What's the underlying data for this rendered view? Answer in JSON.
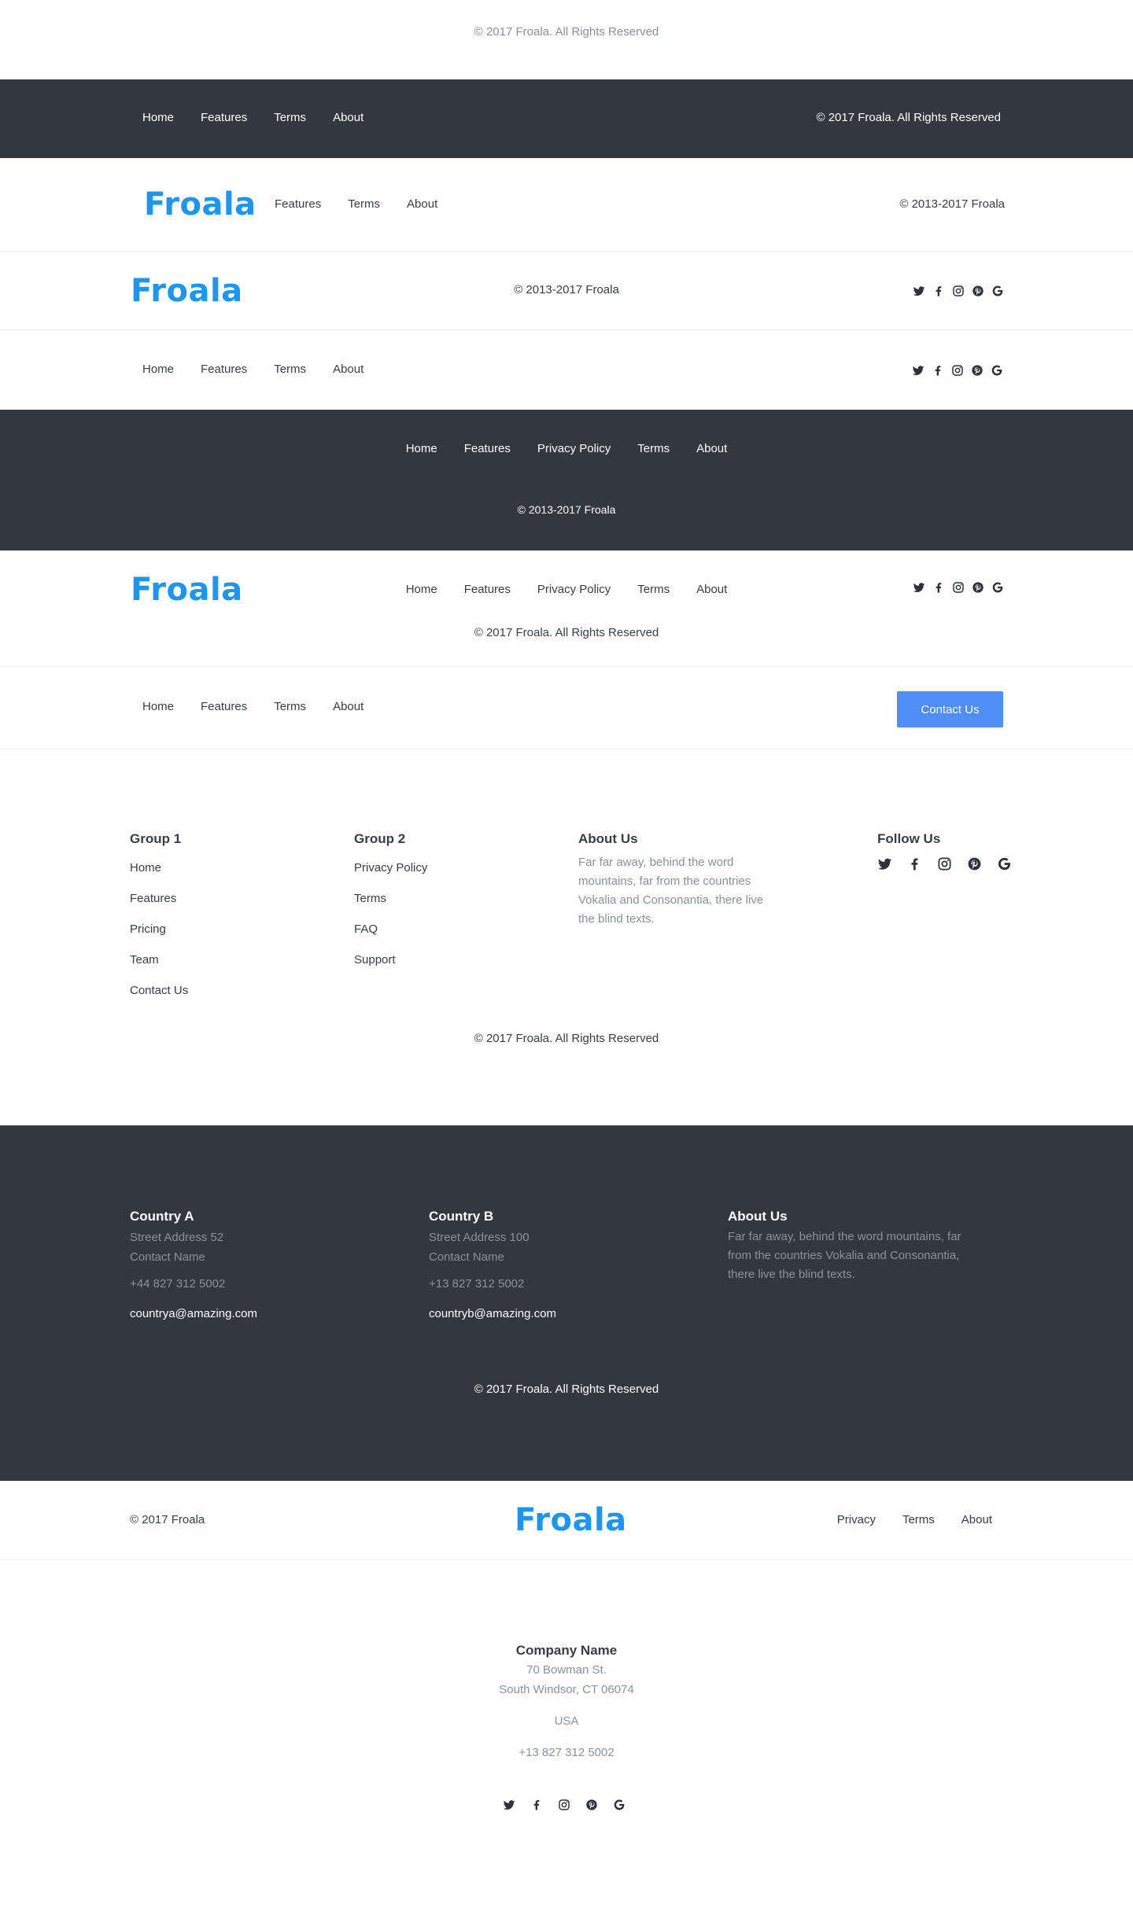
{
  "brand": {
    "logo": "Froala",
    "accent": "#1e95f0",
    "dark_bg": "#33373f",
    "button_color": "#4f8ff7"
  },
  "icons": [
    "twitter-icon",
    "facebook-icon",
    "instagram-icon",
    "pinterest-icon",
    "google-icon"
  ],
  "f1": {
    "copyright": "© 2017 Froala. All Rights Reserved"
  },
  "f2": {
    "nav": [
      "Home",
      "Features",
      "Terms",
      "About"
    ],
    "copyright": "© 2017 Froala. All Rights Reserved"
  },
  "f3": {
    "nav": [
      "Features",
      "Terms",
      "About"
    ],
    "copyright": "© 2013-2017 Froala"
  },
  "f4": {
    "copyright": "© 2013-2017 Froala"
  },
  "f5": {
    "nav": [
      "Home",
      "Features",
      "Terms",
      "About"
    ]
  },
  "f6": {
    "nav": [
      "Home",
      "Features",
      "Privacy Policy",
      "Terms",
      "About"
    ],
    "copyright": "© 2013-2017 Froala"
  },
  "f7": {
    "nav": [
      "Home",
      "Features",
      "Privacy Policy",
      "Terms",
      "About"
    ],
    "copyright": "© 2017 Froala. All Rights Reserved"
  },
  "f8": {
    "nav": [
      "Home",
      "Features",
      "Terms",
      "About"
    ],
    "button": "Contact Us"
  },
  "f9": {
    "group1": {
      "title": "Group 1",
      "links": [
        "Home",
        "Features",
        "Pricing",
        "Team",
        "Contact Us"
      ]
    },
    "group2": {
      "title": "Group 2",
      "links": [
        "Privacy Policy",
        "Terms",
        "FAQ",
        "Support"
      ]
    },
    "about": {
      "title": "About Us",
      "text": "Far far away, behind the word mountains, far from the countries Vokalia and Consonantia, there live the blind texts."
    },
    "follow": {
      "title": "Follow Us"
    },
    "copyright": "© 2017 Froala. All Rights Reserved"
  },
  "f10": {
    "country_a": {
      "title": "Country A",
      "street": "Street Address 52",
      "contact": "Contact Name",
      "phone": "+44 827 312 5002",
      "email": "countrya@amazing.com"
    },
    "country_b": {
      "title": "Country B",
      "street": "Street Address 100",
      "contact": "Contact Name",
      "phone": "+13 827 312 5002",
      "email": "countryb@amazing.com"
    },
    "about": {
      "title": "About Us",
      "text": "Far far away, behind the word mountains, far from the countries Vokalia and Consonantia, there live the blind texts."
    },
    "copyright": "© 2017 Froala. All Rights Reserved"
  },
  "f11": {
    "copyright": "© 2017 Froala",
    "nav": [
      "Privacy",
      "Terms",
      "About"
    ]
  },
  "f12": {
    "company": "Company Name",
    "street": "70 Bowman St.",
    "city": "South Windsor, CT 06074",
    "country": "USA",
    "phone": "+13 827 312 5002"
  }
}
